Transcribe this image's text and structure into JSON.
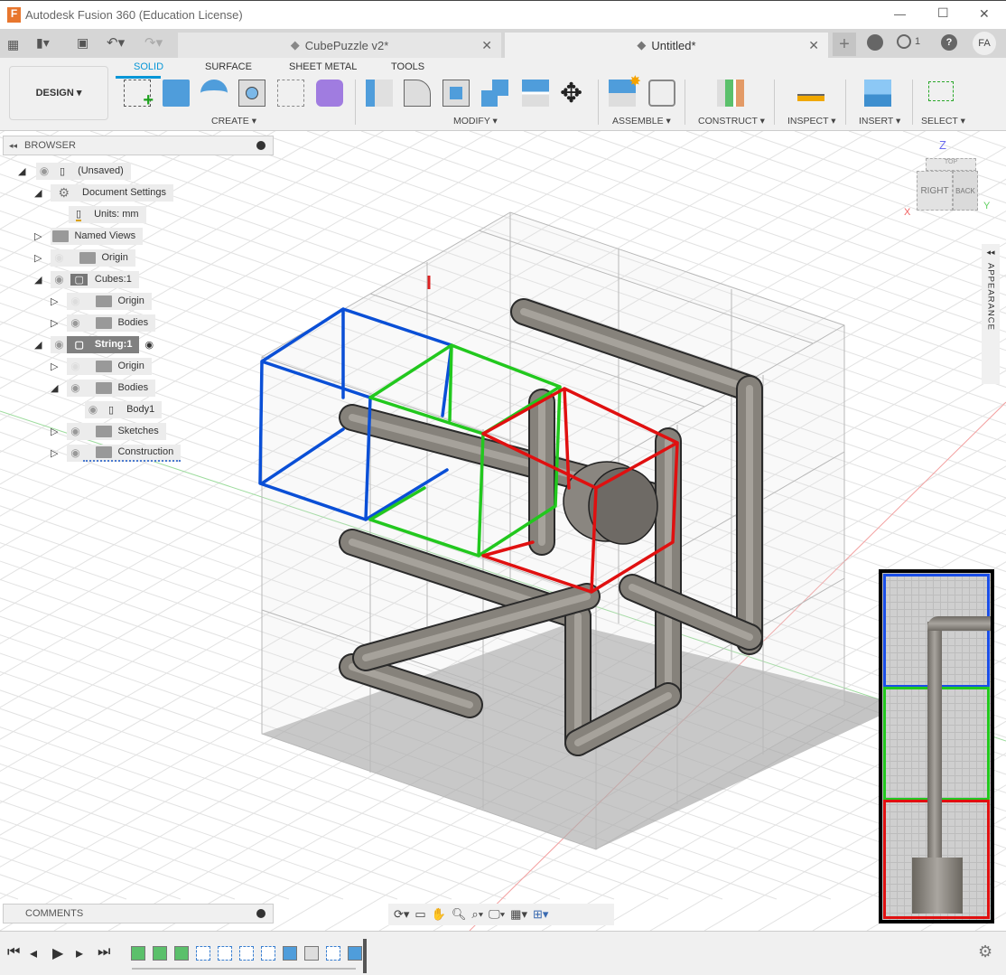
{
  "window": {
    "title": "Autodesk Fusion 360 (Education License)",
    "min": "—",
    "max": "☐",
    "close": "✕"
  },
  "tabs": [
    {
      "label": "CubePuzzle v2*",
      "close": "✕"
    },
    {
      "label": "Untitled*",
      "close": "✕"
    }
  ],
  "tabbar": {
    "new_tab": "+",
    "jobs_count": "1",
    "help": "?",
    "user": "FA"
  },
  "ribbon": {
    "workspace": "DESIGN ▾",
    "tabs": [
      "SOLID",
      "SURFACE",
      "SHEET METAL",
      "TOOLS"
    ],
    "active_tab": "SOLID",
    "groups": [
      "CREATE ▾",
      "MODIFY ▾",
      "ASSEMBLE ▾",
      "CONSTRUCT ▾",
      "INSPECT ▾",
      "INSERT ▾",
      "SELECT ▾"
    ]
  },
  "browser": {
    "title": "BROWSER",
    "items": [
      {
        "label": "(Unsaved)"
      },
      {
        "label": "Document Settings"
      },
      {
        "label": "Units: mm"
      },
      {
        "label": "Named Views"
      },
      {
        "label": "Origin"
      },
      {
        "label": "Cubes:1"
      },
      {
        "label": "Origin"
      },
      {
        "label": "Bodies"
      },
      {
        "label": "String:1"
      },
      {
        "label": "Origin"
      },
      {
        "label": "Bodies"
      },
      {
        "label": "Body1"
      },
      {
        "label": "Sketches"
      },
      {
        "label": "Construction"
      }
    ]
  },
  "viewcube": {
    "right": "RIGHT",
    "back": "BACK",
    "top": "TOP",
    "z": "Z",
    "x": "X",
    "y": "Y"
  },
  "appearance": {
    "label": "APPEARANCE"
  },
  "comments": {
    "title": "COMMENTS"
  },
  "colors": {
    "accent": "#0696d7",
    "blue_scribble": "#0a4fd6",
    "green_scribble": "#22c81e",
    "red_scribble": "#e01010"
  }
}
